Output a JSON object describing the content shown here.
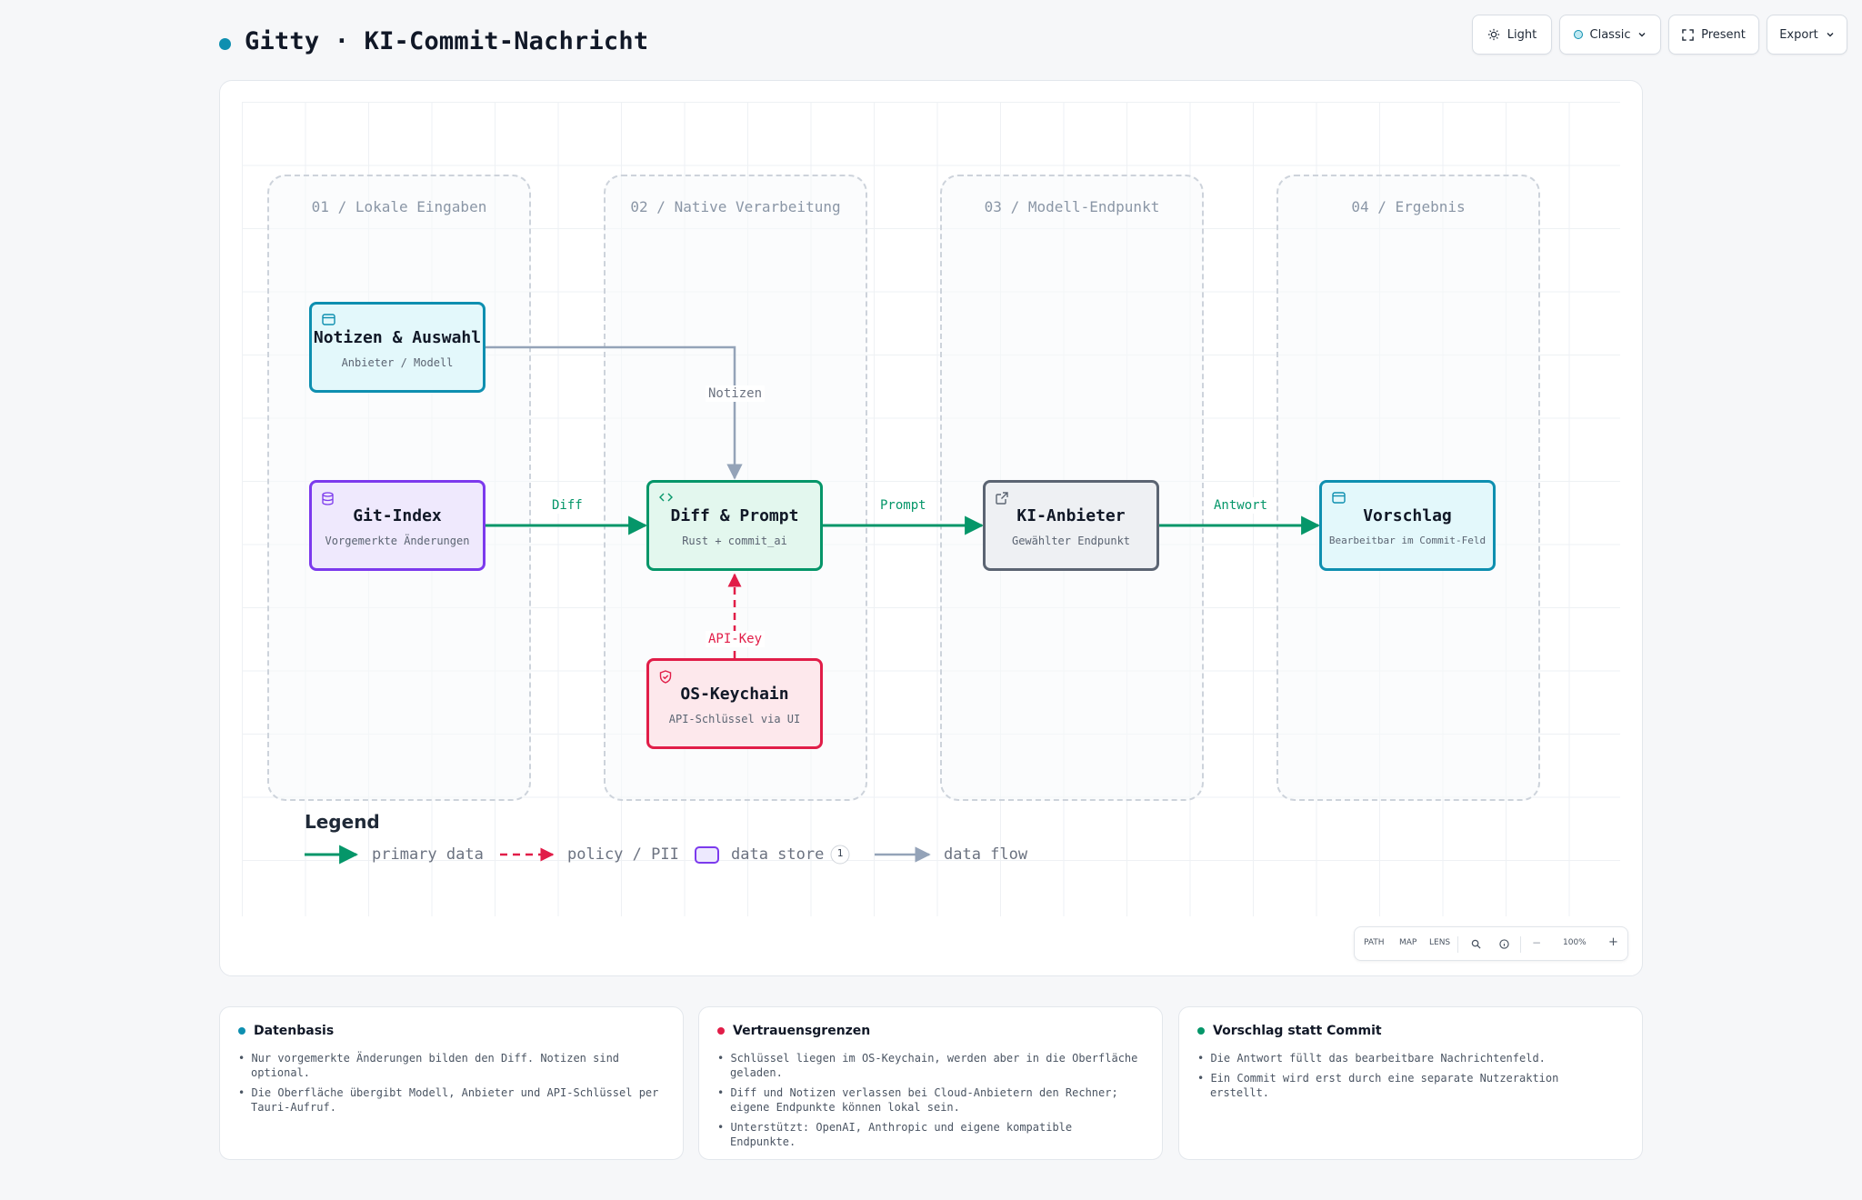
{
  "header": {
    "title": "Gitty · KI-Commit-Nachricht",
    "buttons": {
      "light": "Light",
      "classic": "Classic",
      "present": "Present",
      "export": "Export"
    }
  },
  "lanes": [
    {
      "title": "01 / Lokale Eingaben"
    },
    {
      "title": "02 / Native Verarbeitung"
    },
    {
      "title": "03 / Modell-Endpunkt"
    },
    {
      "title": "04 / Ergebnis"
    }
  ],
  "nodes": {
    "notes": {
      "title": "Notizen & Auswahl",
      "subtitle": "Anbieter / Modell",
      "icon": "window-icon"
    },
    "git_index": {
      "title": "Git-Index",
      "subtitle": "Vorgemerkte Änderungen",
      "icon": "database-icon"
    },
    "diff_prompt": {
      "title": "Diff & Prompt",
      "subtitle": "Rust + commit_ai",
      "icon": "code-icon"
    },
    "keychain": {
      "title": "OS-Keychain",
      "subtitle": "API-Schlüssel via UI",
      "icon": "shield-icon"
    },
    "provider": {
      "title": "KI-Anbieter",
      "subtitle": "Gewählter Endpunkt",
      "icon": "external-link-icon"
    },
    "suggestion": {
      "title": "Vorschlag",
      "subtitle": "Bearbeitbar im Commit-Feld",
      "icon": "window-icon"
    }
  },
  "edges": {
    "diff": "Diff",
    "prompt": "Prompt",
    "antwort": "Antwort",
    "notizen": "Notizen",
    "api_key": "API-Key"
  },
  "legend": {
    "title": "Legend",
    "primary": "primary data",
    "policy": "policy / PII",
    "store": "data store",
    "store_count": "1",
    "flow": "data flow"
  },
  "controls": {
    "path": "PATH",
    "map": "MAP",
    "lens": "LENS",
    "minus": "−",
    "zoom": "100%",
    "plus": "+"
  },
  "info_cards": [
    {
      "title": "Datenbasis",
      "color": "#0e8fb0",
      "items": [
        "Nur vorgemerkte Änderungen bilden den Diff. Notizen sind optional.",
        "Die Oberfläche übergibt Modell, Anbieter und API-Schlüssel per Tauri-Aufruf."
      ]
    },
    {
      "title": "Vertrauensgrenzen",
      "color": "#e11d48",
      "items": [
        "Schlüssel liegen im OS-Keychain, werden aber in die Oberfläche geladen.",
        "Diff und Notizen verlassen bei Cloud-Anbietern den Rechner; eigene Endpunkte können lokal sein.",
        "Unterstützt: OpenAI, Anthropic und eigene kompatible Endpunkte."
      ]
    },
    {
      "title": "Vorschlag statt Commit",
      "color": "#059669",
      "items": [
        "Die Antwort füllt das bearbeitbare Nachrichtenfeld.",
        "Ein Commit wird erst durch eine separate Nutzeraktion erstellt."
      ]
    }
  ],
  "colors": {
    "primary": "#059669",
    "policy": "#e11d48",
    "flow": "#94a3b8",
    "accent": "#0e8fb0"
  }
}
